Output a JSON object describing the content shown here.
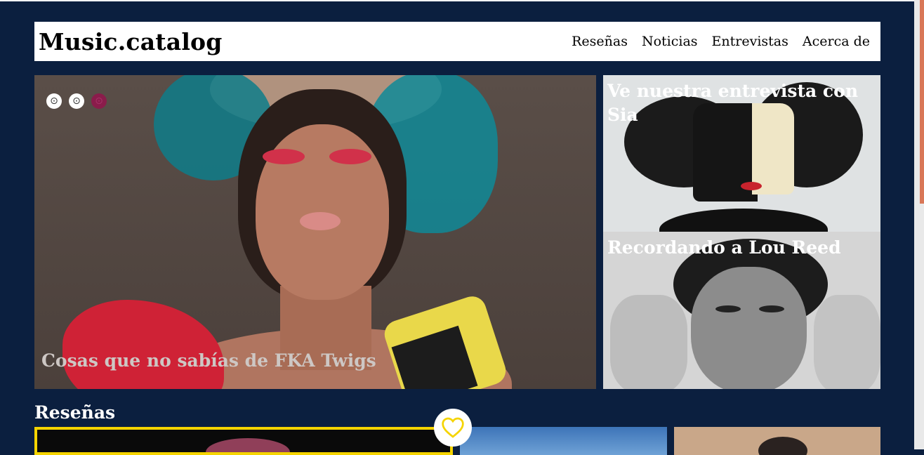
{
  "brand": "Music.catalog",
  "nav": [
    {
      "label": "Reseñas"
    },
    {
      "label": "Noticias"
    },
    {
      "label": "Entrevistas"
    },
    {
      "label": "Acerca de"
    }
  ],
  "hero": {
    "title": "Cosas que no sabías de FKA Twigs",
    "slider_dots": [
      {
        "glyph": "⊙",
        "active": false
      },
      {
        "glyph": "⊙",
        "active": false
      },
      {
        "glyph": "⊙",
        "active": true
      }
    ]
  },
  "side_articles": [
    {
      "title": "Ve nuestra entrevista con Sia"
    },
    {
      "title": "Recordando a Lou Reed"
    }
  ],
  "reviews": {
    "section_title": "Reseñas",
    "favorite_icon": "heart-icon",
    "accent_color": "#f5d400"
  },
  "colors": {
    "page_background": "#0b1f3f",
    "active_dot": "#8a1c4b"
  }
}
